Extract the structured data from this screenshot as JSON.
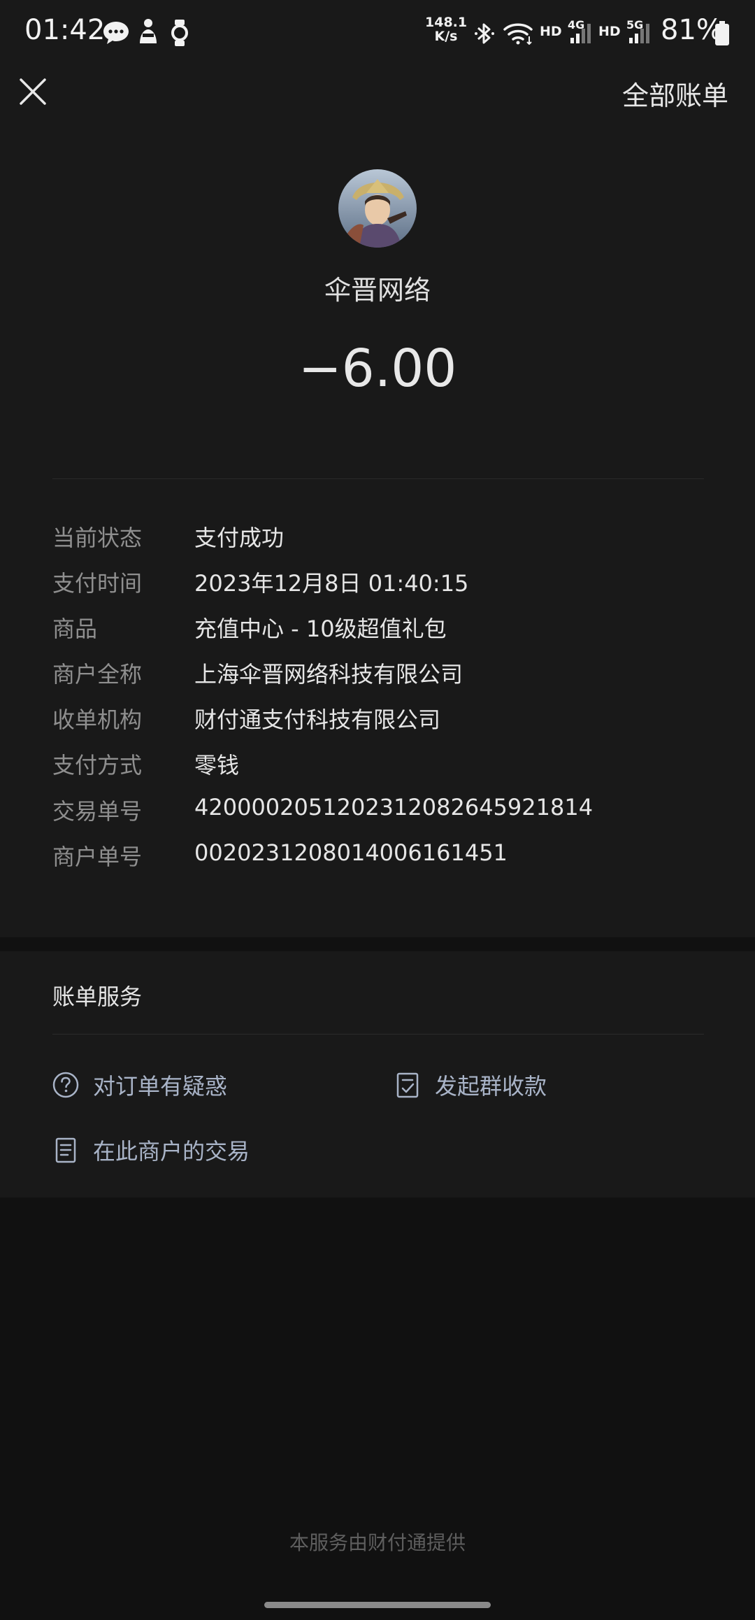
{
  "status_bar": {
    "time": "01:42",
    "net_speed_value": "148.1",
    "net_speed_unit": "K/s",
    "hd1": "HD",
    "hd2": "HD",
    "sig1": "4G",
    "sig2": "5G",
    "battery": "81%",
    "icons": [
      "chat-bubble-icon",
      "notification-app-icon",
      "watch-icon",
      "bluetooth-icon",
      "wifi-icon",
      "signal-4g-icon",
      "signal-5g-icon",
      "battery-icon"
    ]
  },
  "header": {
    "close_icon": "close-icon",
    "all_bills_label": "全部账单"
  },
  "merchant": {
    "name": "伞晋网络",
    "amount": "−6.00"
  },
  "details": [
    {
      "label": "当前状态",
      "value": "支付成功"
    },
    {
      "label": "支付时间",
      "value": "2023年12月8日 01:40:15"
    },
    {
      "label": "商品",
      "value": "充值中心 - 10级超值礼包"
    },
    {
      "label": "商户全称",
      "value": "上海伞晋网络科技有限公司"
    },
    {
      "label": "收单机构",
      "value": "财付通支付科技有限公司"
    },
    {
      "label": "支付方式",
      "value": "零钱"
    },
    {
      "label": "交易单号",
      "value": "4200002051202312082645921814"
    },
    {
      "label": "商户单号",
      "value": "0020231208014006161451"
    }
  ],
  "services": {
    "title": "账单服务",
    "items": [
      {
        "label": "对订单有疑惑",
        "icon": "question-circle-icon"
      },
      {
        "label": "发起群收款",
        "icon": "checklist-icon"
      },
      {
        "label": "在此商户的交易",
        "icon": "document-icon"
      }
    ]
  },
  "footer": {
    "text": "本服务由财付通提供"
  },
  "colors": {
    "background": "#111111",
    "card": "#191919",
    "label_gray": "#8f8f8f",
    "link_blue_gray": "#a9b4c8"
  }
}
